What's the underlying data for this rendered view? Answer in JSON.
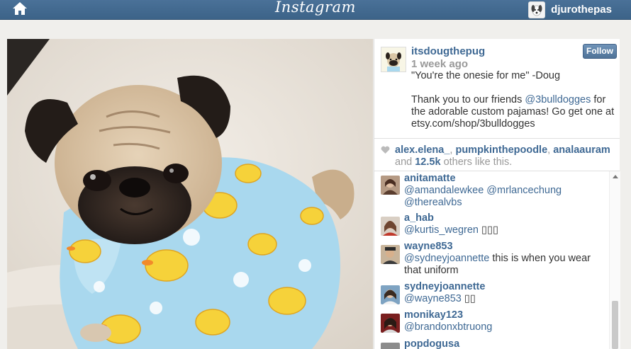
{
  "header": {
    "logo": "Instagram",
    "username": "djurothepas",
    "home_icon": "home-icon"
  },
  "post": {
    "owner": "itsdougthepug",
    "time_ago": "1 week ago",
    "follow_label": "Follow",
    "caption_line1": "\"You're the onesie for me\" -Doug",
    "caption_pre": "Thank you to our friends ",
    "caption_mention": "@3bulldogges",
    "caption_post": " for the adorable custom pajamas! Go get one at etsy.com/shop/3bulldogges"
  },
  "likes": {
    "users": [
      "alex.elena_",
      "pumpkinthepoodle",
      "analaauram"
    ],
    "and": "and",
    "count": "12.5k",
    "suffix": "others like this."
  },
  "comments": [
    {
      "user": "anitamatte",
      "mentions": "@amandalewkee @mrlancechung @therealvbs",
      "text": ""
    },
    {
      "user": "a_hab",
      "mentions": "@kurtis_wegren",
      "text": "▯▯▯"
    },
    {
      "user": "wayne853",
      "mentions": "@sydneyjoannette",
      "text": " this is when you wear that uniform"
    },
    {
      "user": "sydneyjoannette",
      "mentions": "@wayne853",
      "text": "▯▯"
    },
    {
      "user": "monikay123",
      "mentions": "@brandonxbtruong",
      "text": ""
    },
    {
      "user": "popdogusa",
      "mentions": "",
      "text": ""
    }
  ],
  "colors": {
    "header": "#4a7198",
    "link": "#3f6994",
    "onesie": "#a9d8ee",
    "duck": "#f6d23a"
  }
}
